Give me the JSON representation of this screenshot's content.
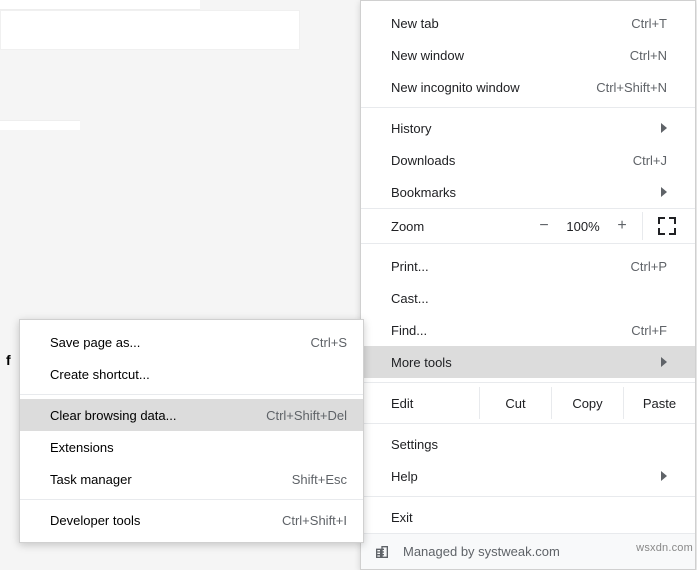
{
  "main_menu": {
    "group1": {
      "new_tab": {
        "label": "New tab",
        "shortcut": "Ctrl+T"
      },
      "new_window": {
        "label": "New window",
        "shortcut": "Ctrl+N"
      },
      "new_incognito": {
        "label": "New incognito window",
        "shortcut": "Ctrl+Shift+N"
      }
    },
    "group2": {
      "history": {
        "label": "History"
      },
      "downloads": {
        "label": "Downloads",
        "shortcut": "Ctrl+J"
      },
      "bookmarks": {
        "label": "Bookmarks"
      }
    },
    "zoom": {
      "label": "Zoom",
      "level": "100%"
    },
    "group3": {
      "print": {
        "label": "Print...",
        "shortcut": "Ctrl+P"
      },
      "cast": {
        "label": "Cast..."
      },
      "find": {
        "label": "Find...",
        "shortcut": "Ctrl+F"
      },
      "more_tools": {
        "label": "More tools"
      }
    },
    "edit": {
      "label": "Edit",
      "cut": "Cut",
      "copy": "Copy",
      "paste": "Paste"
    },
    "group4": {
      "settings": {
        "label": "Settings"
      },
      "help": {
        "label": "Help"
      }
    },
    "exit": {
      "label": "Exit"
    },
    "managed": "Managed by systweak.com"
  },
  "submenu": {
    "save_as": {
      "label": "Save page as...",
      "shortcut": "Ctrl+S"
    },
    "create_shortcut": {
      "label": "Create shortcut..."
    },
    "clear_data": {
      "label": "Clear browsing data...",
      "shortcut": "Ctrl+Shift+Del"
    },
    "extensions": {
      "label": "Extensions"
    },
    "task_manager": {
      "label": "Task manager",
      "shortcut": "Shift+Esc"
    },
    "dev_tools": {
      "label": "Developer tools",
      "shortcut": "Ctrl+Shift+I"
    }
  },
  "page": {
    "char": "f"
  },
  "watermark": "wsxdn.com"
}
